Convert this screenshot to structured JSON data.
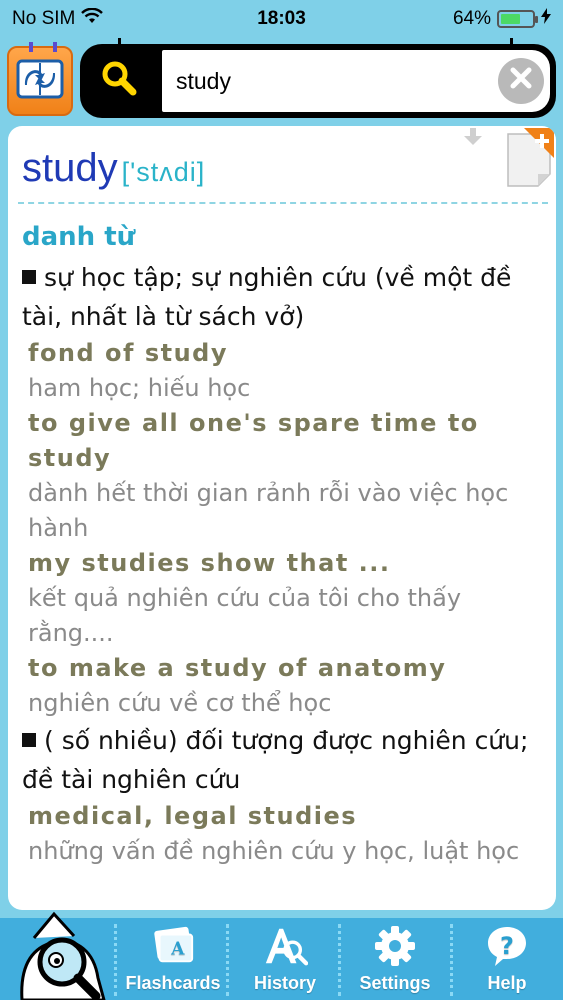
{
  "status_bar": {
    "carrier": "No SIM",
    "time": "18:03",
    "battery": "64%",
    "battery_level": 0.64
  },
  "search": {
    "value": "study",
    "placeholder": ""
  },
  "entry": {
    "headword": "study",
    "phonetic": "['stʌdi]",
    "part_of_speech": "danh từ",
    "senses": [
      {
        "definition": "sự học tập; sự nghiên cứu (về một đề tài, nhất là từ sách vở)",
        "examples": [
          {
            "en": "fond of study",
            "vi": "ham học; hiếu học"
          },
          {
            "en": "to give all one's spare time to study",
            "vi": "dành hết thời gian rảnh rỗi vào việc học hành"
          },
          {
            "en": "my studies show that ...",
            "vi": "kết quả nghiên cứu của tôi cho thấy rằng...."
          },
          {
            "en": "to make a study of anatomy",
            "vi": "nghiên cứu về cơ thể học"
          }
        ]
      },
      {
        "definition": "( số nhiều) đối tượng được nghiên cứu; đề tài nghiên cứu",
        "examples": [
          {
            "en": "medical, legal studies",
            "vi": "những vấn đề nghiên cứu y học, luật học"
          }
        ]
      }
    ]
  },
  "tabs": {
    "flashcards": "Flashcards",
    "history": "History",
    "settings": "Settings",
    "help": "Help"
  },
  "colors": {
    "background": "#7fd0e8",
    "tabbar": "#41aedd",
    "headword": "#1f3ab5",
    "accent": "#2aa6c8",
    "app_icon": "#f08118"
  }
}
